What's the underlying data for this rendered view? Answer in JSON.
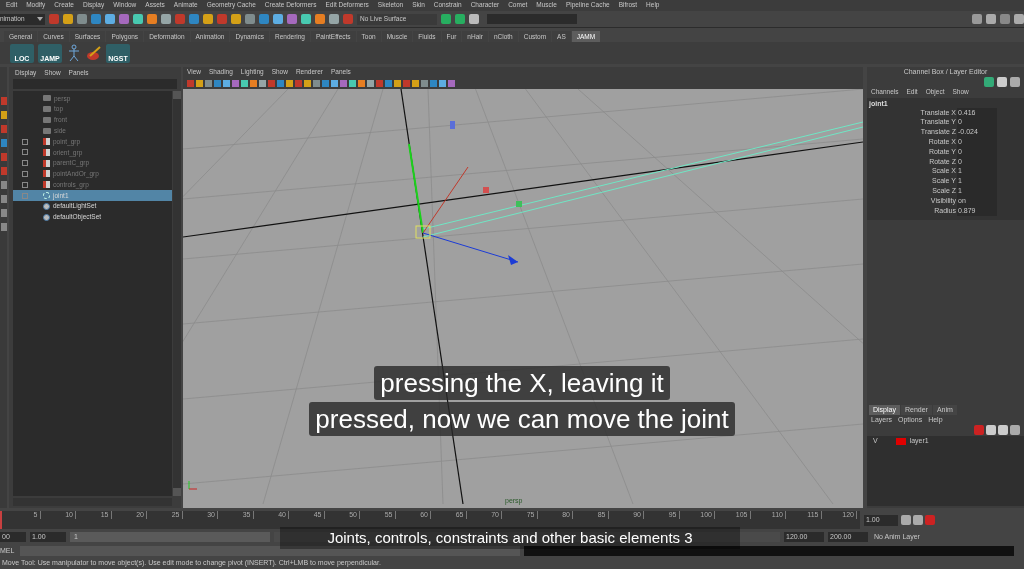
{
  "menu_bar": [
    "Edit",
    "Modify",
    "Create",
    "Display",
    "Window",
    "Assets",
    "Animate",
    "Geometry Cache",
    "Create Deformers",
    "Edit Deformers",
    "Skeleton",
    "Skin",
    "Constrain",
    "Character",
    "Comet",
    "Muscle",
    "Pipeline Cache",
    "Bifrost",
    "Help"
  ],
  "toolbar": {
    "mode": "nimation",
    "live_surface": "No Live Surface"
  },
  "shelf_tabs": [
    {
      "label": "General",
      "selected": false
    },
    {
      "label": "Curves",
      "selected": false
    },
    {
      "label": "Surfaces",
      "selected": false
    },
    {
      "label": "Polygons",
      "selected": false
    },
    {
      "label": "Deformation",
      "selected": false
    },
    {
      "label": "Animation",
      "selected": false
    },
    {
      "label": "Dynamics",
      "selected": false
    },
    {
      "label": "Rendering",
      "selected": false
    },
    {
      "label": "PaintEffects",
      "selected": false
    },
    {
      "label": "Toon",
      "selected": false
    },
    {
      "label": "Muscle",
      "selected": false
    },
    {
      "label": "Fluids",
      "selected": false
    },
    {
      "label": "Fur",
      "selected": false
    },
    {
      "label": "nHair",
      "selected": false
    },
    {
      "label": "nCloth",
      "selected": false
    },
    {
      "label": "Custom",
      "selected": false
    },
    {
      "label": "AS",
      "selected": false
    },
    {
      "label": "JAMM",
      "selected": true
    }
  ],
  "shelf_buttons": [
    {
      "kind": "label",
      "label": "LOC"
    },
    {
      "kind": "label",
      "label": "JAMP"
    },
    {
      "kind": "skeleton"
    },
    {
      "kind": "paint"
    },
    {
      "kind": "label",
      "label": "NGST"
    }
  ],
  "outliner": {
    "menu": [
      "Display",
      "Show",
      "Panels"
    ],
    "items": [
      {
        "label": "persp",
        "kind": "camera",
        "has_children": false,
        "dimmed": true,
        "selected": false
      },
      {
        "label": "top",
        "kind": "camera",
        "has_children": false,
        "dimmed": true,
        "selected": false
      },
      {
        "label": "front",
        "kind": "camera",
        "has_children": false,
        "dimmed": true,
        "selected": false
      },
      {
        "label": "side",
        "kind": "camera",
        "has_children": false,
        "dimmed": true,
        "selected": false
      },
      {
        "label": "point_grp",
        "kind": "group",
        "has_children": true,
        "dimmed": true,
        "selected": false
      },
      {
        "label": "orient_grp",
        "kind": "group",
        "has_children": true,
        "dimmed": true,
        "selected": false
      },
      {
        "label": "parentC_grp",
        "kind": "group",
        "has_children": true,
        "dimmed": true,
        "selected": false
      },
      {
        "label": "pointAndOr_grp",
        "kind": "group",
        "has_children": true,
        "dimmed": true,
        "selected": false
      },
      {
        "label": "controls_grp",
        "kind": "group",
        "has_children": true,
        "dimmed": true,
        "selected": false
      },
      {
        "label": "joint1",
        "kind": "joint",
        "has_children": true,
        "dimmed": false,
        "selected": true
      },
      {
        "label": "defaultLightSet",
        "kind": "set",
        "has_children": false,
        "dimmed": false,
        "selected": false
      },
      {
        "label": "defaultObjectSet",
        "kind": "set",
        "has_children": false,
        "dimmed": false,
        "selected": false
      }
    ]
  },
  "viewport": {
    "menu": [
      "View",
      "Shading",
      "Lighting",
      "Show",
      "Renderer",
      "Panels"
    ],
    "camera_label": "persp"
  },
  "captions": [
    "pressing the X, leaving it",
    "pressed, now we can move the joint"
  ],
  "channel_box": {
    "title": "Channel Box / Layer Editor",
    "menu": [
      "Channels",
      "Edit",
      "Object",
      "Show"
    ],
    "node": "joint1",
    "attributes": [
      {
        "name": "Translate X",
        "value": "0.416"
      },
      {
        "name": "Translate Y",
        "value": "0"
      },
      {
        "name": "Translate Z",
        "value": "-0.024"
      },
      {
        "name": "Rotate X",
        "value": "0"
      },
      {
        "name": "Rotate Y",
        "value": "0"
      },
      {
        "name": "Rotate Z",
        "value": "0"
      },
      {
        "name": "Scale X",
        "value": "1"
      },
      {
        "name": "Scale Y",
        "value": "1"
      },
      {
        "name": "Scale Z",
        "value": "1"
      },
      {
        "name": "Visibility",
        "value": "on"
      },
      {
        "name": "Radius",
        "value": "0.879"
      }
    ]
  },
  "layer_editor": {
    "tabs": [
      {
        "label": "Display",
        "selected": true
      },
      {
        "label": "Render",
        "selected": false
      },
      {
        "label": "Anim",
        "selected": false
      }
    ],
    "menu": [
      "Layers",
      "Options",
      "Help"
    ],
    "layers": [
      {
        "visible_mark": "V",
        "name": "layer1",
        "color": "#e00000"
      }
    ]
  },
  "timeline": {
    "ticks": [
      "5",
      "10",
      "15",
      "20",
      "25",
      "30",
      "35",
      "40",
      "45",
      "50",
      "55",
      "60",
      "65",
      "70",
      "75",
      "80",
      "85",
      "90",
      "95",
      "100",
      "105",
      "110",
      "115",
      "120"
    ],
    "current_time": "1.00",
    "level": 0
  },
  "range": {
    "start": "00",
    "playback_start": "1.00",
    "slider_start": "1",
    "level": 1,
    "playback_end": "120.00",
    "end": "200.00",
    "anim_layer": "No Anim Layer"
  },
  "command_line": {
    "label": "MEL"
  },
  "video_title": "Joints, controls, constraints and other basic elements 3",
  "help_line": "Move Tool: Use manipulator to move object(s). Use edit mode to change pivot (INSERT). Ctrl+LMB to move perpendicular."
}
